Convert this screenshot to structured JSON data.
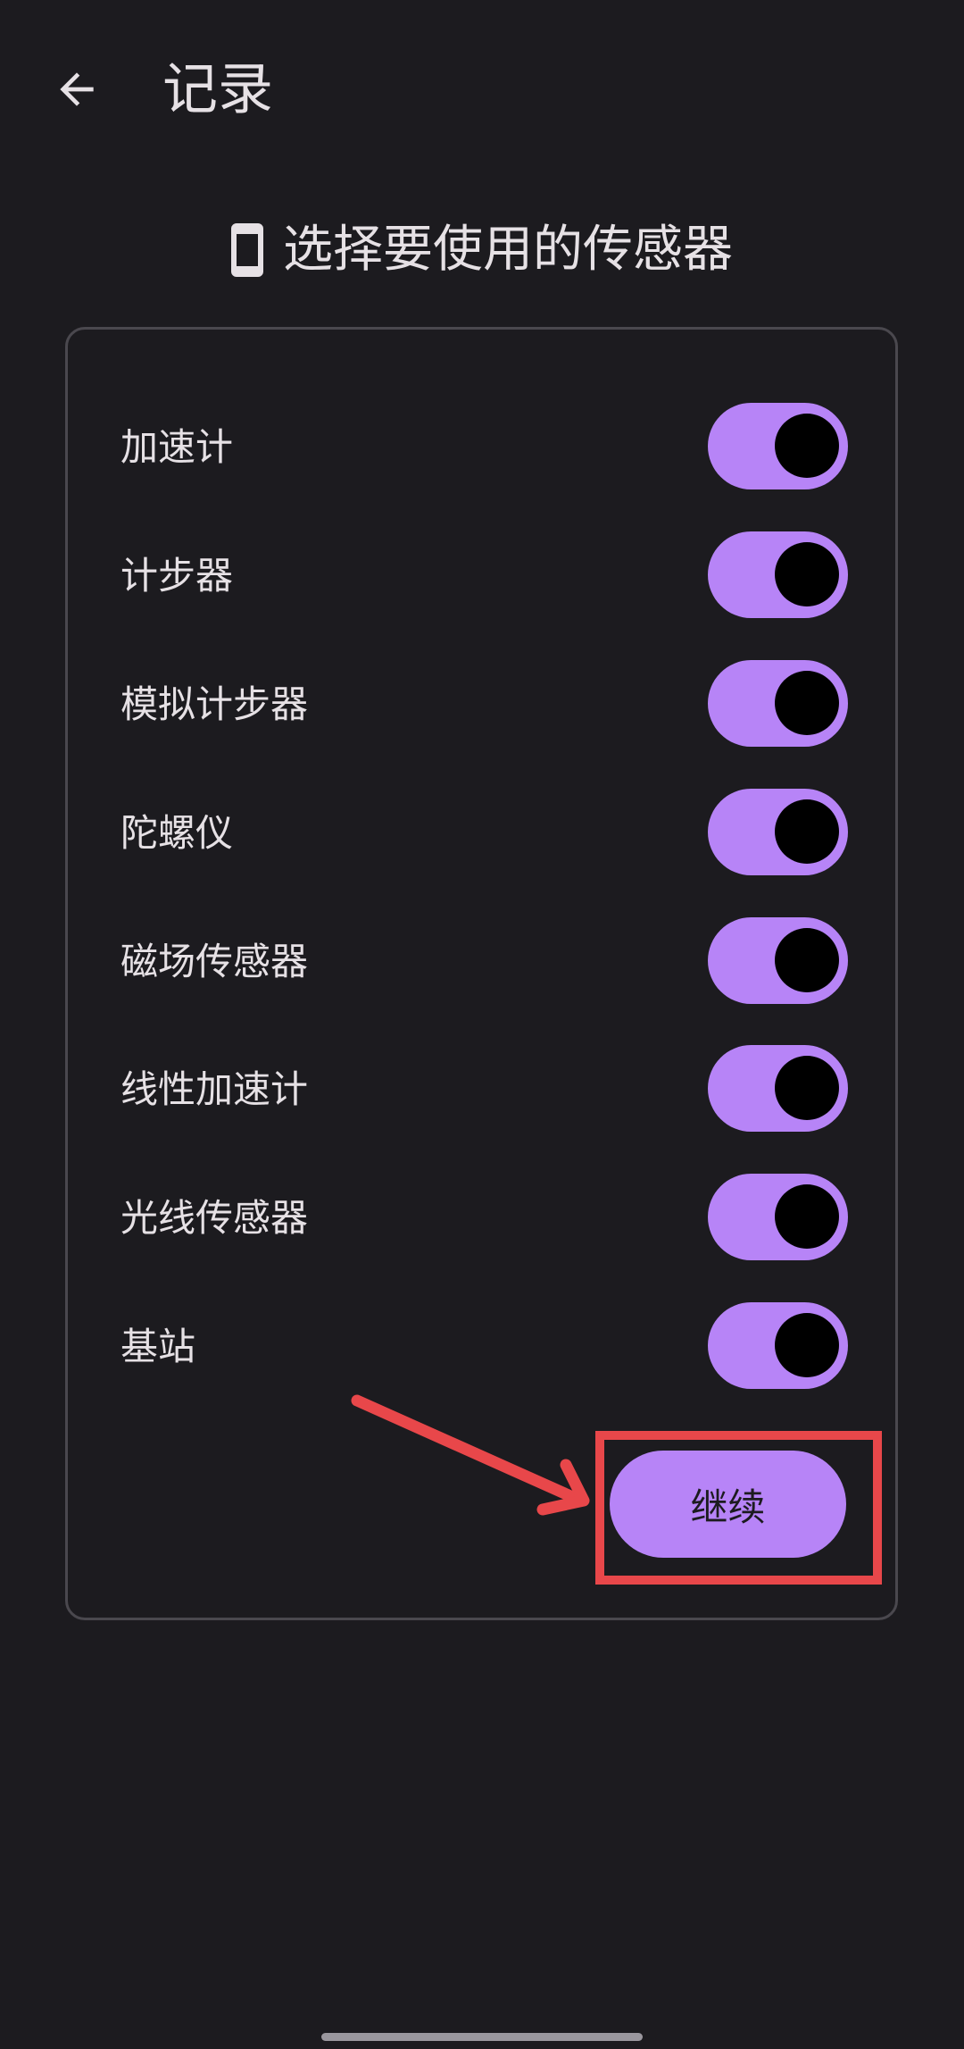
{
  "header": {
    "title": "记录",
    "back_icon": "arrow-left-icon"
  },
  "section": {
    "title": "选择要使用的传感器",
    "icon": "phone-icon"
  },
  "sensors": [
    {
      "label": "加速计",
      "enabled": true
    },
    {
      "label": "计步器",
      "enabled": true
    },
    {
      "label": "模拟计步器",
      "enabled": true
    },
    {
      "label": "陀螺仪",
      "enabled": true
    },
    {
      "label": "磁场传感器",
      "enabled": true
    },
    {
      "label": "线性加速计",
      "enabled": true
    },
    {
      "label": "光线传感器",
      "enabled": true
    },
    {
      "label": "基站",
      "enabled": true
    }
  ],
  "actions": {
    "continue_label": "继续"
  },
  "colors": {
    "background": "#1c1b1f",
    "accent": "#b784f7",
    "annotation": "#e8474a"
  }
}
